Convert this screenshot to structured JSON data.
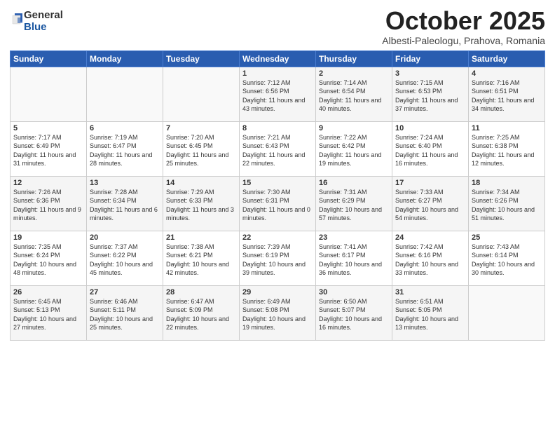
{
  "logo": {
    "general": "General",
    "blue": "Blue"
  },
  "header": {
    "month": "October 2025",
    "location": "Albesti-Paleologu, Prahova, Romania"
  },
  "days_of_week": [
    "Sunday",
    "Monday",
    "Tuesday",
    "Wednesday",
    "Thursday",
    "Friday",
    "Saturday"
  ],
  "weeks": [
    [
      {
        "day": "",
        "info": ""
      },
      {
        "day": "",
        "info": ""
      },
      {
        "day": "",
        "info": ""
      },
      {
        "day": "1",
        "info": "Sunrise: 7:12 AM\nSunset: 6:56 PM\nDaylight: 11 hours and 43 minutes."
      },
      {
        "day": "2",
        "info": "Sunrise: 7:14 AM\nSunset: 6:54 PM\nDaylight: 11 hours and 40 minutes."
      },
      {
        "day": "3",
        "info": "Sunrise: 7:15 AM\nSunset: 6:53 PM\nDaylight: 11 hours and 37 minutes."
      },
      {
        "day": "4",
        "info": "Sunrise: 7:16 AM\nSunset: 6:51 PM\nDaylight: 11 hours and 34 minutes."
      }
    ],
    [
      {
        "day": "5",
        "info": "Sunrise: 7:17 AM\nSunset: 6:49 PM\nDaylight: 11 hours and 31 minutes."
      },
      {
        "day": "6",
        "info": "Sunrise: 7:19 AM\nSunset: 6:47 PM\nDaylight: 11 hours and 28 minutes."
      },
      {
        "day": "7",
        "info": "Sunrise: 7:20 AM\nSunset: 6:45 PM\nDaylight: 11 hours and 25 minutes."
      },
      {
        "day": "8",
        "info": "Sunrise: 7:21 AM\nSunset: 6:43 PM\nDaylight: 11 hours and 22 minutes."
      },
      {
        "day": "9",
        "info": "Sunrise: 7:22 AM\nSunset: 6:42 PM\nDaylight: 11 hours and 19 minutes."
      },
      {
        "day": "10",
        "info": "Sunrise: 7:24 AM\nSunset: 6:40 PM\nDaylight: 11 hours and 16 minutes."
      },
      {
        "day": "11",
        "info": "Sunrise: 7:25 AM\nSunset: 6:38 PM\nDaylight: 11 hours and 12 minutes."
      }
    ],
    [
      {
        "day": "12",
        "info": "Sunrise: 7:26 AM\nSunset: 6:36 PM\nDaylight: 11 hours and 9 minutes."
      },
      {
        "day": "13",
        "info": "Sunrise: 7:28 AM\nSunset: 6:34 PM\nDaylight: 11 hours and 6 minutes."
      },
      {
        "day": "14",
        "info": "Sunrise: 7:29 AM\nSunset: 6:33 PM\nDaylight: 11 hours and 3 minutes."
      },
      {
        "day": "15",
        "info": "Sunrise: 7:30 AM\nSunset: 6:31 PM\nDaylight: 11 hours and 0 minutes."
      },
      {
        "day": "16",
        "info": "Sunrise: 7:31 AM\nSunset: 6:29 PM\nDaylight: 10 hours and 57 minutes."
      },
      {
        "day": "17",
        "info": "Sunrise: 7:33 AM\nSunset: 6:27 PM\nDaylight: 10 hours and 54 minutes."
      },
      {
        "day": "18",
        "info": "Sunrise: 7:34 AM\nSunset: 6:26 PM\nDaylight: 10 hours and 51 minutes."
      }
    ],
    [
      {
        "day": "19",
        "info": "Sunrise: 7:35 AM\nSunset: 6:24 PM\nDaylight: 10 hours and 48 minutes."
      },
      {
        "day": "20",
        "info": "Sunrise: 7:37 AM\nSunset: 6:22 PM\nDaylight: 10 hours and 45 minutes."
      },
      {
        "day": "21",
        "info": "Sunrise: 7:38 AM\nSunset: 6:21 PM\nDaylight: 10 hours and 42 minutes."
      },
      {
        "day": "22",
        "info": "Sunrise: 7:39 AM\nSunset: 6:19 PM\nDaylight: 10 hours and 39 minutes."
      },
      {
        "day": "23",
        "info": "Sunrise: 7:41 AM\nSunset: 6:17 PM\nDaylight: 10 hours and 36 minutes."
      },
      {
        "day": "24",
        "info": "Sunrise: 7:42 AM\nSunset: 6:16 PM\nDaylight: 10 hours and 33 minutes."
      },
      {
        "day": "25",
        "info": "Sunrise: 7:43 AM\nSunset: 6:14 PM\nDaylight: 10 hours and 30 minutes."
      }
    ],
    [
      {
        "day": "26",
        "info": "Sunrise: 6:45 AM\nSunset: 5:13 PM\nDaylight: 10 hours and 27 minutes."
      },
      {
        "day": "27",
        "info": "Sunrise: 6:46 AM\nSunset: 5:11 PM\nDaylight: 10 hours and 25 minutes."
      },
      {
        "day": "28",
        "info": "Sunrise: 6:47 AM\nSunset: 5:09 PM\nDaylight: 10 hours and 22 minutes."
      },
      {
        "day": "29",
        "info": "Sunrise: 6:49 AM\nSunset: 5:08 PM\nDaylight: 10 hours and 19 minutes."
      },
      {
        "day": "30",
        "info": "Sunrise: 6:50 AM\nSunset: 5:07 PM\nDaylight: 10 hours and 16 minutes."
      },
      {
        "day": "31",
        "info": "Sunrise: 6:51 AM\nSunset: 5:05 PM\nDaylight: 10 hours and 13 minutes."
      },
      {
        "day": "",
        "info": ""
      }
    ]
  ]
}
